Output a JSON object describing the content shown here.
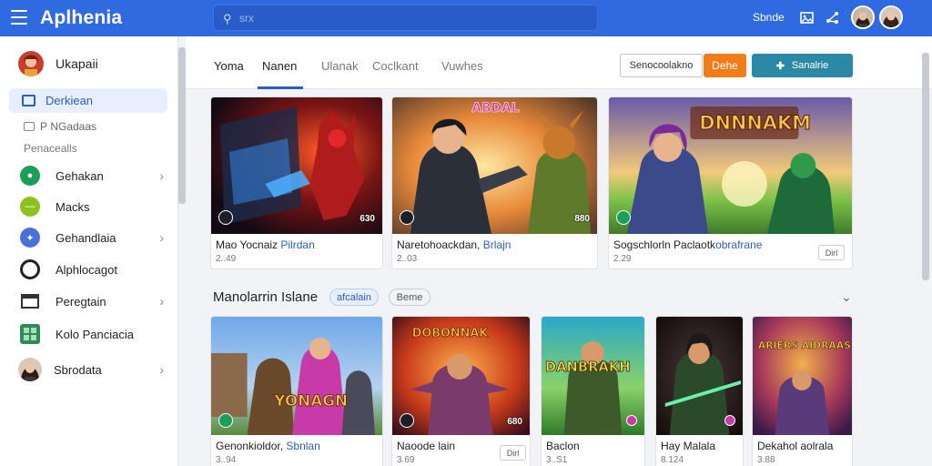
{
  "app": {
    "title": "Aplhenia"
  },
  "search": {
    "placeholder": "srx"
  },
  "topbar": {
    "link": "Sbnde"
  },
  "sidebar": {
    "profile_name": "Ukapaii",
    "active_item": "Derkiean",
    "sub_item": "P NGadaas",
    "section_label": "Penacealls",
    "items": [
      {
        "label": "Gehakan",
        "icon": "chat-icon",
        "color": "#1a9e5a",
        "has_chevron": true
      },
      {
        "label": "Macks",
        "icon": "lime-dot-icon",
        "color": "#8bc21f",
        "has_chevron": false
      },
      {
        "label": "Gehandlaia",
        "icon": "star-icon",
        "color": "#4a6fd8",
        "has_chevron": true
      },
      {
        "label": "Alphlocagot",
        "icon": "ring-icon",
        "color": "#222222",
        "has_chevron": false
      },
      {
        "label": "Peregtain",
        "icon": "mail-icon",
        "color": "#333333",
        "has_chevron": true
      },
      {
        "label": "Kolo Panciacia",
        "icon": "grid-icon",
        "color": "#2e8b57",
        "has_chevron": false
      },
      {
        "label": "Sbrodata",
        "icon": "avatar-icon",
        "color": "#555555",
        "has_chevron": true
      }
    ]
  },
  "tabs": [
    {
      "label": "Yoma",
      "active": false
    },
    {
      "label": "Nanen",
      "active": true
    },
    {
      "label": "Ulanak",
      "active": false
    },
    {
      "label": "Coclkant",
      "active": false
    },
    {
      "label": "Vuwhes",
      "active": false
    }
  ],
  "actions": {
    "outline_label": "Senocoolakno",
    "orange_label": "Dehe",
    "teal_label": "Sanalrie"
  },
  "row1": [
    {
      "title_a": "Mao Yocnaiz ",
      "title_b": "Pilrdan",
      "meta": "2..49",
      "badge": "630",
      "has_tag": false,
      "tag": ""
    },
    {
      "title_a": "Naretohoackdan, ",
      "title_b": "Brlajn",
      "meta": "2..03",
      "badge": "880",
      "has_tag": false,
      "tag": "",
      "art_text": "ABDAL"
    },
    {
      "title_a": "Sogschlorln Paclaotk",
      "title_b": "obrafrane",
      "meta": "2.29",
      "badge": "",
      "has_tag": true,
      "tag": "Dirl",
      "art_text": "DNNNAKM"
    }
  ],
  "section": {
    "title": "Manolarrin Islane",
    "chip_a": "afcalain",
    "chip_b": "Beme"
  },
  "row2": [
    {
      "title_a": "Genonkioldor, ",
      "title_b": "Sbnlan",
      "meta": "3..94",
      "badge": "",
      "has_tag": false,
      "tag": "",
      "art_text": "YONAGN"
    },
    {
      "title_a": "Naoode lain",
      "title_b": "",
      "meta": "3.69",
      "badge": "680",
      "has_tag": true,
      "tag": "Dirl",
      "art_text": "DOBONNAK"
    },
    {
      "title_a": "Baclon",
      "title_b": "",
      "meta": "3..S1",
      "badge": "",
      "has_tag": false,
      "tag": "",
      "art_text": "DANBRAKH"
    },
    {
      "title_a": "Hay Malala",
      "title_b": "",
      "meta": "8.124",
      "badge": "",
      "has_tag": false,
      "tag": ""
    },
    {
      "title_a": "Dekahol aolrala",
      "title_b": "",
      "meta": "3.88",
      "badge": "",
      "has_tag": false,
      "tag": "",
      "art_text": "ARIERS AIDRAAS"
    }
  ]
}
